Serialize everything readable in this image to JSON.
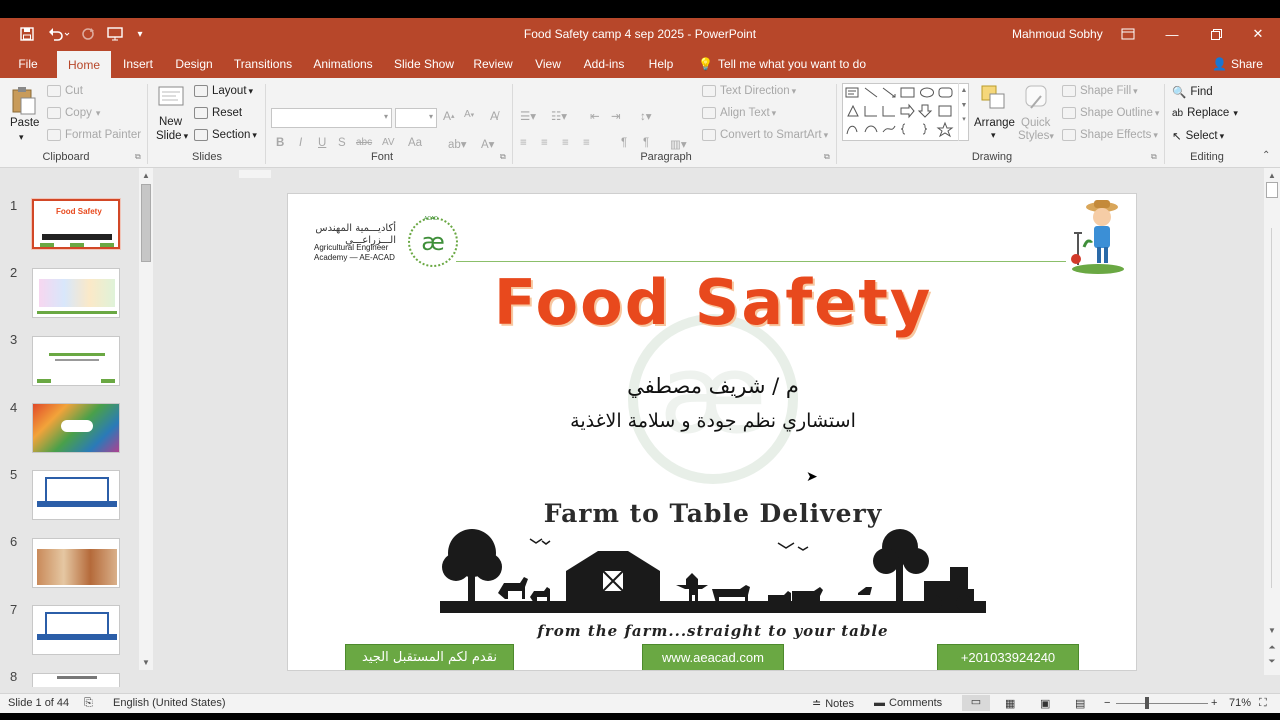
{
  "title_bar": {
    "document_title": "Food Safety camp 4 sep 2025  -  PowerPoint",
    "user": "Mahmoud Sobhy",
    "quick_access": [
      "save-icon",
      "undo-icon",
      "redo-icon",
      "start-from-beginning-icon",
      "customize-qat-icon"
    ]
  },
  "tabs": [
    "File",
    "Home",
    "Insert",
    "Design",
    "Transitions",
    "Animations",
    "Slide Show",
    "Review",
    "View",
    "Add-ins",
    "Help"
  ],
  "active_tab": "Home",
  "tell_me": "Tell me what you want to do",
  "share": "Share",
  "ribbon": {
    "clipboard": {
      "paste": "Paste",
      "cut": "Cut",
      "copy": "Copy",
      "format_painter": "Format Painter",
      "label": "Clipboard"
    },
    "slides": {
      "new_slide": "New",
      "new_slide_2": "Slide",
      "layout": "Layout",
      "reset": "Reset",
      "section": "Section",
      "label": "Slides"
    },
    "font": {
      "label": "Font",
      "buttons": [
        "B",
        "I",
        "U",
        "S",
        "abc",
        "AV",
        "Aa"
      ]
    },
    "paragraph": {
      "text_direction": "Text Direction",
      "align_text": "Align Text",
      "convert_smartart": "Convert to SmartArt",
      "label": "Paragraph"
    },
    "drawing": {
      "arrange": "Arrange",
      "quick_styles": "Quick",
      "quick_styles_2": "Styles",
      "shape_fill": "Shape Fill",
      "shape_outline": "Shape Outline",
      "shape_effects": "Shape Effects",
      "label": "Drawing"
    },
    "editing": {
      "find": "Find",
      "replace": "Replace",
      "select": "Select",
      "label": "Editing"
    }
  },
  "thumbnails": [
    {
      "num": "1",
      "selected": true
    },
    {
      "num": "2",
      "selected": false
    },
    {
      "num": "3",
      "selected": false
    },
    {
      "num": "4",
      "selected": false
    },
    {
      "num": "5",
      "selected": false
    },
    {
      "num": "6",
      "selected": false
    },
    {
      "num": "7",
      "selected": false
    },
    {
      "num": "8",
      "selected": false
    }
  ],
  "slide": {
    "logo_arabic_1": "أكاديـــمية المهندس",
    "logo_arabic_2": "الـــزراعـــي",
    "logo_en_1": "Agricultural Engineer",
    "logo_en_2": "Academy — AE-ACAD",
    "logo_badge": "ACAD",
    "logo_mark": "æ",
    "title": "Food Safety",
    "presenter": "م / شريف مصطفي",
    "role": "استشاري نظم جودة و سلامة الاغذية",
    "banner": "Farm to Table Delivery",
    "tagline": "from the farm...straight to your table",
    "box_left": "نقدم لكم المستقبل الجيد",
    "box_center": "www.aeacad.com",
    "box_right": "+201033924240"
  },
  "status": {
    "slide_counter": "Slide 1 of 44",
    "language": "English (United States)",
    "notes": "Notes",
    "comments": "Comments",
    "zoom": "71%"
  },
  "colors": {
    "accent": "#b7472a",
    "title": "#e8491d",
    "green": "#6aa843"
  }
}
